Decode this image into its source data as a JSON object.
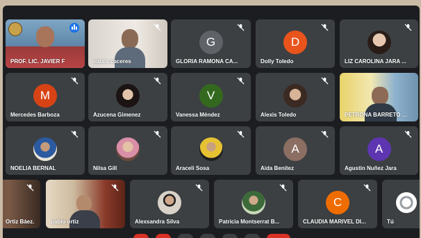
{
  "participants": [
    {
      "name": "PROF. LIC. JAVIER F",
      "type": "video"
    },
    {
      "name": "vidala caceres",
      "type": "video"
    },
    {
      "name": "GLORIA RAMONA CA...",
      "type": "initial",
      "initial": "G",
      "color": "#5f6368"
    },
    {
      "name": "Dolly Toledo",
      "type": "initial",
      "initial": "D",
      "color": "#e8541c"
    },
    {
      "name": "LIZ CAROLINA JARA ...",
      "type": "photo"
    },
    {
      "name": "Mercedes Barboza",
      "type": "initial",
      "initial": "M",
      "color": "#d84315"
    },
    {
      "name": "Azucena Gimenez",
      "type": "photo"
    },
    {
      "name": "Vanessa Méndez",
      "type": "initial",
      "initial": "V",
      "color": "#33691e"
    },
    {
      "name": "Alexis Toledo",
      "type": "photo"
    },
    {
      "name": "PETRONA BARRETO ...",
      "type": "video"
    },
    {
      "name": "NOELIA BERNAL",
      "type": "photo"
    },
    {
      "name": "Nilsa Gill",
      "type": "photo"
    },
    {
      "name": "Araceli Sosa",
      "type": "photo"
    },
    {
      "name": "Aida Benitez",
      "type": "initial",
      "initial": "A",
      "color": "#8d6e63"
    },
    {
      "name": "Agustin Nuñez Jara",
      "type": "initial",
      "initial": "A",
      "color": "#5e35b1"
    },
    {
      "name": "Ortiz Báez.",
      "type": "video"
    },
    {
      "name": "pablo ortiz",
      "type": "video"
    },
    {
      "name": "Alexsandra Silva",
      "type": "photo"
    },
    {
      "name": "Patricia Montserrat B...",
      "type": "photo"
    },
    {
      "name": "CLAUDIA MARIVEL DI...",
      "type": "initial",
      "initial": "C",
      "color": "#ef6c00"
    },
    {
      "name": "Tú",
      "type": "photo"
    }
  ],
  "icons": {
    "mute": "mic-off-icon",
    "speaking": "speaking-indicator-icon"
  },
  "colors": {
    "tile": "#3c4043",
    "highlight": "#8ab4f8",
    "background": "#1c1d20"
  }
}
